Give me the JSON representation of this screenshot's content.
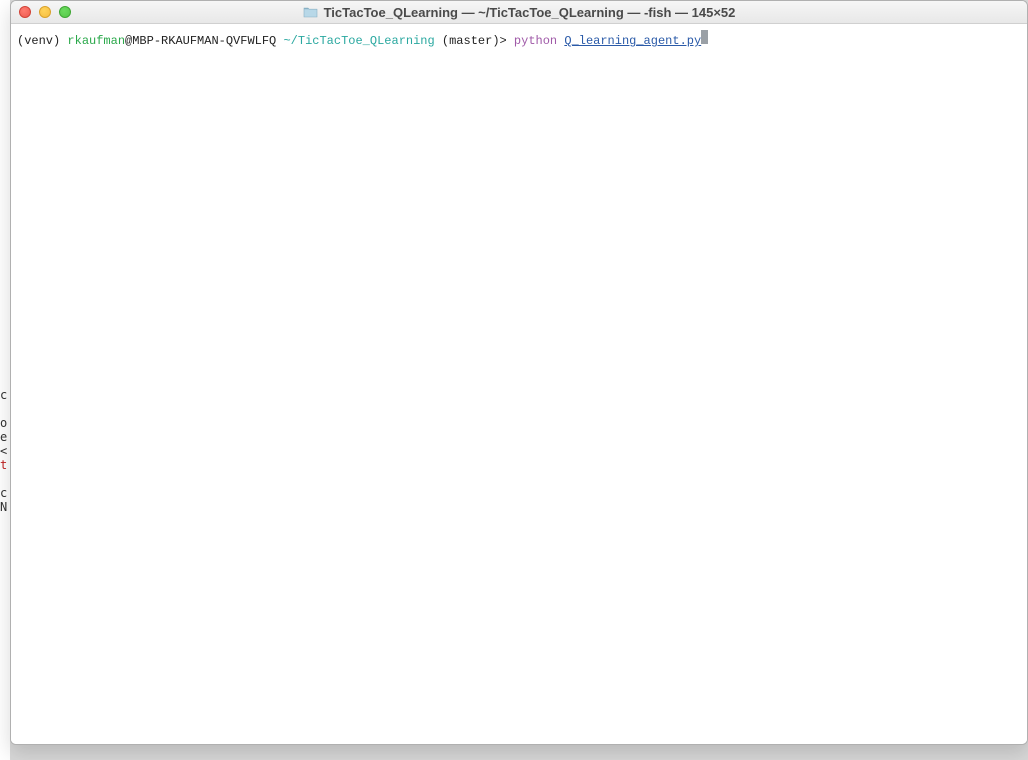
{
  "left_remnant": {
    "lines": [
      "",
      "c",
      "",
      "o",
      "e",
      "<",
      "t",
      "",
      "c",
      "N"
    ],
    "red_index": 6
  },
  "window": {
    "title": "TicTacToe_QLearning — ~/TicTacToe_QLearning — -fish — 145×52",
    "folder_icon": "folder-icon"
  },
  "prompt": {
    "venv": "(venv) ",
    "user": "rkaufman",
    "at_host": "@MBP-RKAUFMAN-QVFWLFQ ",
    "path": "~/TicTacToe_QLearning",
    "branch": " (master)> ",
    "cmd": "python ",
    "filearg": "Q_learning_agent.py"
  }
}
